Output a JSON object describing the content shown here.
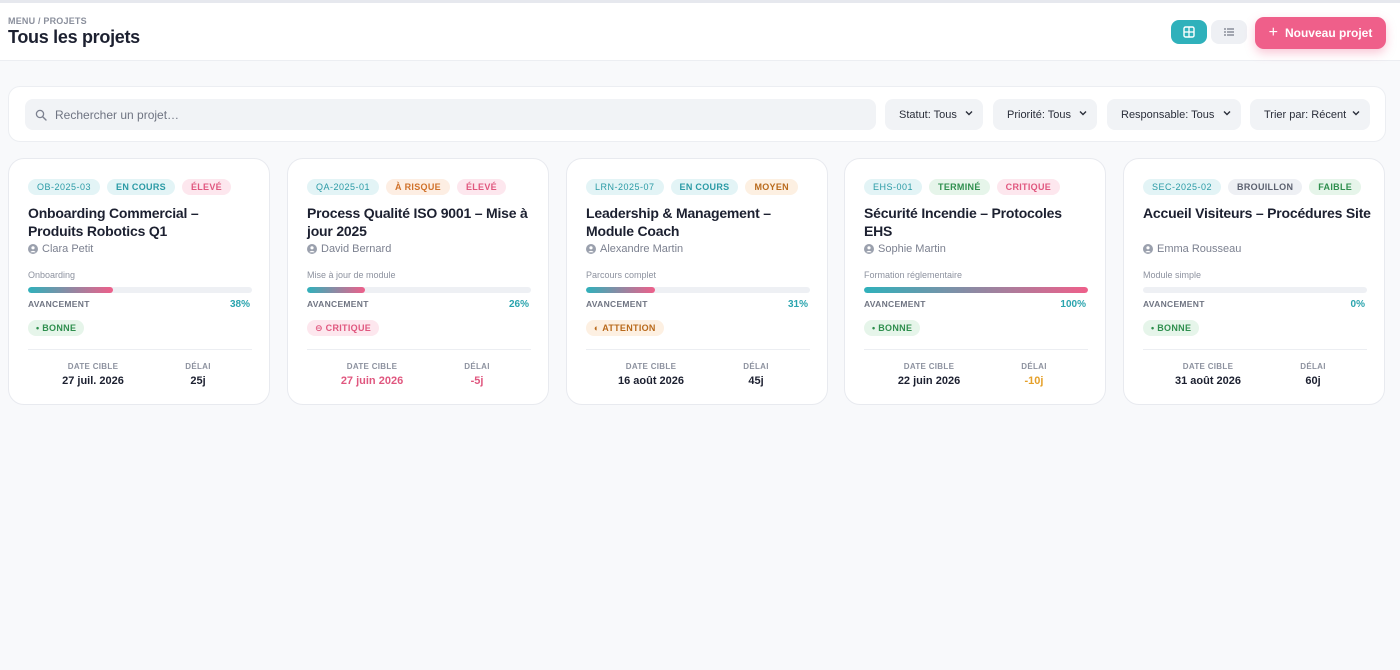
{
  "header": {
    "breadcrumb": "MENU / PROJETS",
    "title": "Tous les projets",
    "new_project_label": "Nouveau projet",
    "grid_view_icon": "grid-icon",
    "list_view_icon": "list-icon"
  },
  "filters": {
    "search_placeholder": "Rechercher un projet…",
    "search_value": "",
    "status": "Statut: Tous",
    "priority": "Priorité: Tous",
    "owner": "Responsable: Tous",
    "sort": "Trier par: Récent"
  },
  "labels": {
    "progress": "AVANCEMENT",
    "target_date": "DATE CIBLE",
    "delay": "DÉLAI"
  },
  "colors": {
    "accent": "#2fb1bb",
    "brand": "#ef5f8a"
  },
  "projects": [
    {
      "code": "OB-2025-03",
      "status": "EN COURS",
      "priority": "ÉLEVÉ",
      "title": "Onboarding Commercial – Produits Robotics Q1",
      "owner": "Clara Petit",
      "module": "Onboarding",
      "progress": 38,
      "progress_label": "38%",
      "health": "• BONNE",
      "target_date": "27 juil. 2026",
      "delay": "25j"
    },
    {
      "code": "QA-2025-01",
      "status": "À RISQUE",
      "priority": "ÉLEVÉ",
      "title": "Process Qualité ISO 9001 – Mise à jour 2025",
      "owner": "David Bernard",
      "module": "Mise à jour de module",
      "progress": 26,
      "progress_label": "26%",
      "health": "⊖ CRITIQUE",
      "target_date": "27 juin 2026",
      "delay": "-5j"
    },
    {
      "code": "LRN-2025-07",
      "status": "EN COURS",
      "priority": "MOYEN",
      "title": "Leadership & Management – Module Coach",
      "owner": "Alexandre Martin",
      "module": "Parcours complet",
      "progress": 31,
      "progress_label": "31%",
      "health": "◐ ATTENTION",
      "target_date": "16 août 2026",
      "delay": "45j"
    },
    {
      "code": "EHS-001",
      "status": "TERMINÉ",
      "priority": "CRITIQUE",
      "title": "Sécurité Incendie – Protocoles EHS",
      "owner": "Sophie Martin",
      "module": "Formation réglementaire",
      "progress": 100,
      "progress_label": "100%",
      "health": "• BONNE",
      "target_date": "22 juin 2026",
      "delay": "-10j"
    },
    {
      "code": "SEC-2025-02",
      "status": "BROUILLON",
      "priority": "FAIBLE",
      "title": "Accueil Visiteurs – Procédures Site",
      "owner": "Emma Rousseau",
      "module": "Module simple",
      "progress": 0,
      "progress_label": "0%",
      "health": "• BONNE",
      "target_date": "31 août 2026",
      "delay": "60j"
    }
  ]
}
